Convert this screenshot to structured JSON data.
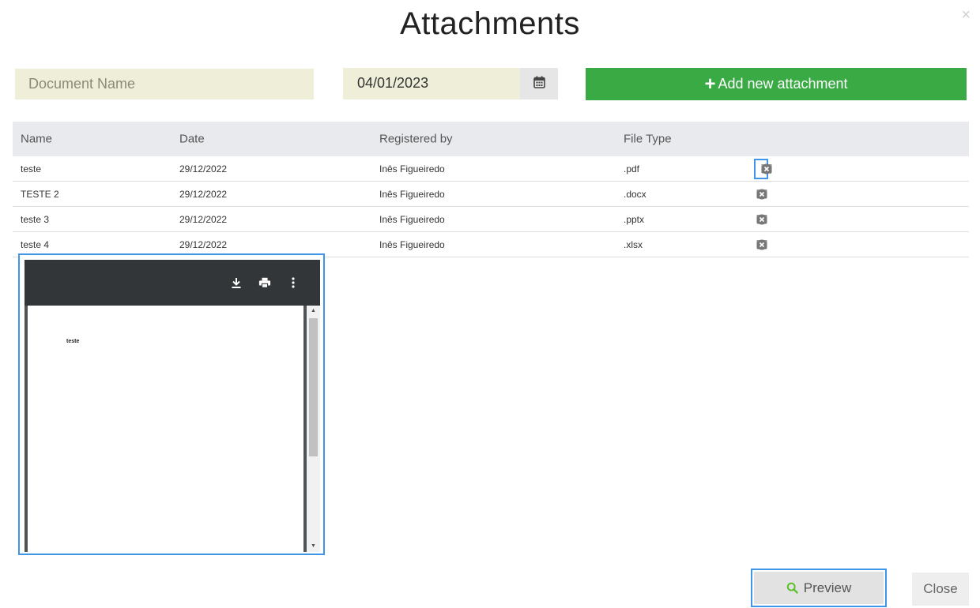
{
  "dialog": {
    "title": "Attachments",
    "close_symbol": "×"
  },
  "form": {
    "document_name_placeholder": "Document Name",
    "date_value": "04/01/2023",
    "add_button_label": "Add new attachment",
    "add_button_icon": "plus-icon",
    "calendar_icon": "calendar-icon"
  },
  "table": {
    "headers": [
      "Name",
      "Date",
      "Registered by",
      "File Type"
    ],
    "rows": [
      {
        "name": "teste",
        "date": "29/12/2022",
        "registered_by": "Inês Figueiredo",
        "file_type": ".pdf",
        "actions": [
          "search-icon",
          "download-icon",
          "delete-icon"
        ]
      },
      {
        "name": "TESTE 2",
        "date": "29/12/2022",
        "registered_by": "Inês Figueiredo",
        "file_type": ".docx",
        "actions": [
          "download-icon",
          "delete-icon"
        ]
      },
      {
        "name": "teste 3",
        "date": "29/12/2022",
        "registered_by": "Inês Figueiredo",
        "file_type": ".pptx",
        "actions": [
          "download-icon",
          "delete-icon"
        ]
      },
      {
        "name": "teste 4",
        "date": "29/12/2022",
        "registered_by": "Inês Figueiredo",
        "file_type": ".xlsx",
        "actions": [
          "download-icon",
          "delete-icon"
        ]
      }
    ]
  },
  "viewer": {
    "toolbar_icons": [
      "download-icon",
      "print-icon",
      "more-vert-icon"
    ],
    "page_text": "teste"
  },
  "footer": {
    "preview_label": "Preview",
    "close_label": "Close"
  },
  "colors": {
    "accent_green": "#3aaa45",
    "highlight_blue": "#3f95e8",
    "input_bg": "#efefd9",
    "header_bg": "#e8eaed"
  }
}
